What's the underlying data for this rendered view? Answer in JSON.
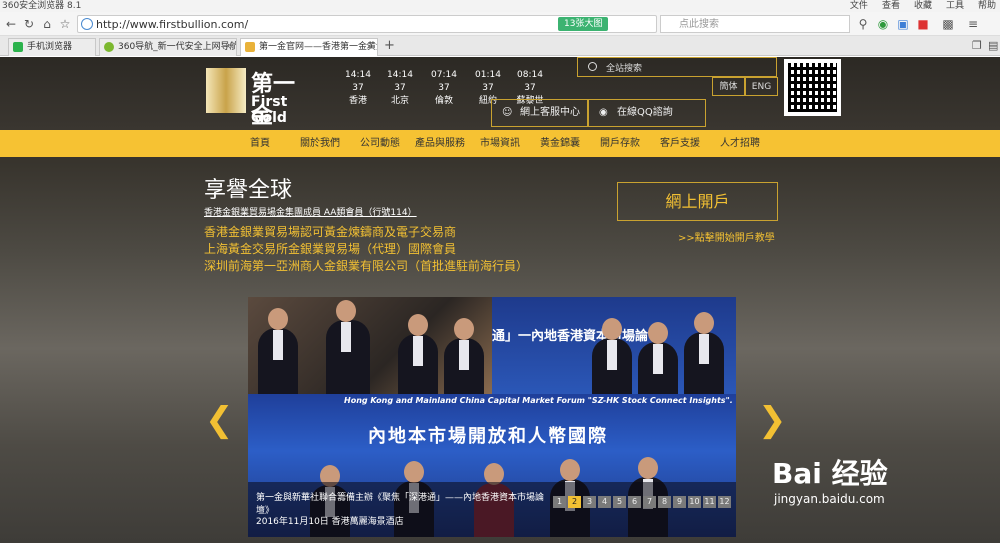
{
  "browser": {
    "title": "360安全浏览器 8.1",
    "menu": [
      "文件",
      "查看",
      "收藏",
      "工具",
      "帮助"
    ],
    "url": "http://www.firstbullion.com/",
    "badge": "13张大图",
    "search_placeholder": "点此搜索",
    "tabs": [
      {
        "label": "手机浏览器",
        "active": false
      },
      {
        "label": "360导航_新一代安全上网导航",
        "active": false
      },
      {
        "label": "第一金官网——香港第一金黄金",
        "active": true
      }
    ],
    "new_tab": "+"
  },
  "site": {
    "logo": {
      "zh": "第一金",
      "en": "First Gold"
    },
    "clocks": [
      {
        "time": "14:14 37",
        "city": "香港"
      },
      {
        "time": "14:14 37",
        "city": "北京"
      },
      {
        "time": "07:14 37",
        "city": "倫敦"
      },
      {
        "time": "01:14 37",
        "city": "紐約"
      },
      {
        "time": "08:14 37",
        "city": "蘇黎世"
      }
    ],
    "search_label": "全站搜索",
    "langs": [
      "簡体",
      "ENG"
    ],
    "service": {
      "online": "網上客服中心",
      "qq": "在線QQ諮詢"
    },
    "nav": [
      "首頁",
      "關於我們",
      "公司動態",
      "產品與服務",
      "市場資訊",
      "黄金錦囊",
      "開戶存款",
      "客戶支援",
      "人才招聘"
    ],
    "hero": {
      "title": "享譽全球",
      "subtitle": "香港金銀業貿易場金集團成員 AA類會員（行號114）",
      "lines": [
        "香港金銀業貿易場認可黃金煉鑄商及電子交易商",
        "上海黃金交易所金銀業貿易場（代理）國際會員",
        "深圳前海第一亞洲商人金銀業有限公司（首批進駐前海行員）"
      ],
      "open_button": "網上開戶",
      "open_link": ">>點擊開始開戶教學"
    },
    "slider": {
      "top_banner": "通」一內地香港資本市場論",
      "bottom_en": "Hong Kong and Mainland China Capital Market Forum \"SZ-HK Stock Connect Insights\".",
      "bottom_zh": "內地本市場開放和人幣國際",
      "caption_title": "第一金與新華社聯合籌備主辦《聚焦「深港通」——內地香港資本市場論壇》",
      "caption_date": "2016年11月10日 香港萬麗海景酒店",
      "pages": [
        "1",
        "2",
        "3",
        "4",
        "5",
        "6",
        "7",
        "8",
        "9",
        "10",
        "11",
        "12"
      ],
      "active_page": "2"
    },
    "watermark": {
      "brand": "Bai 经验",
      "url": "jingyan.baidu.com"
    }
  }
}
